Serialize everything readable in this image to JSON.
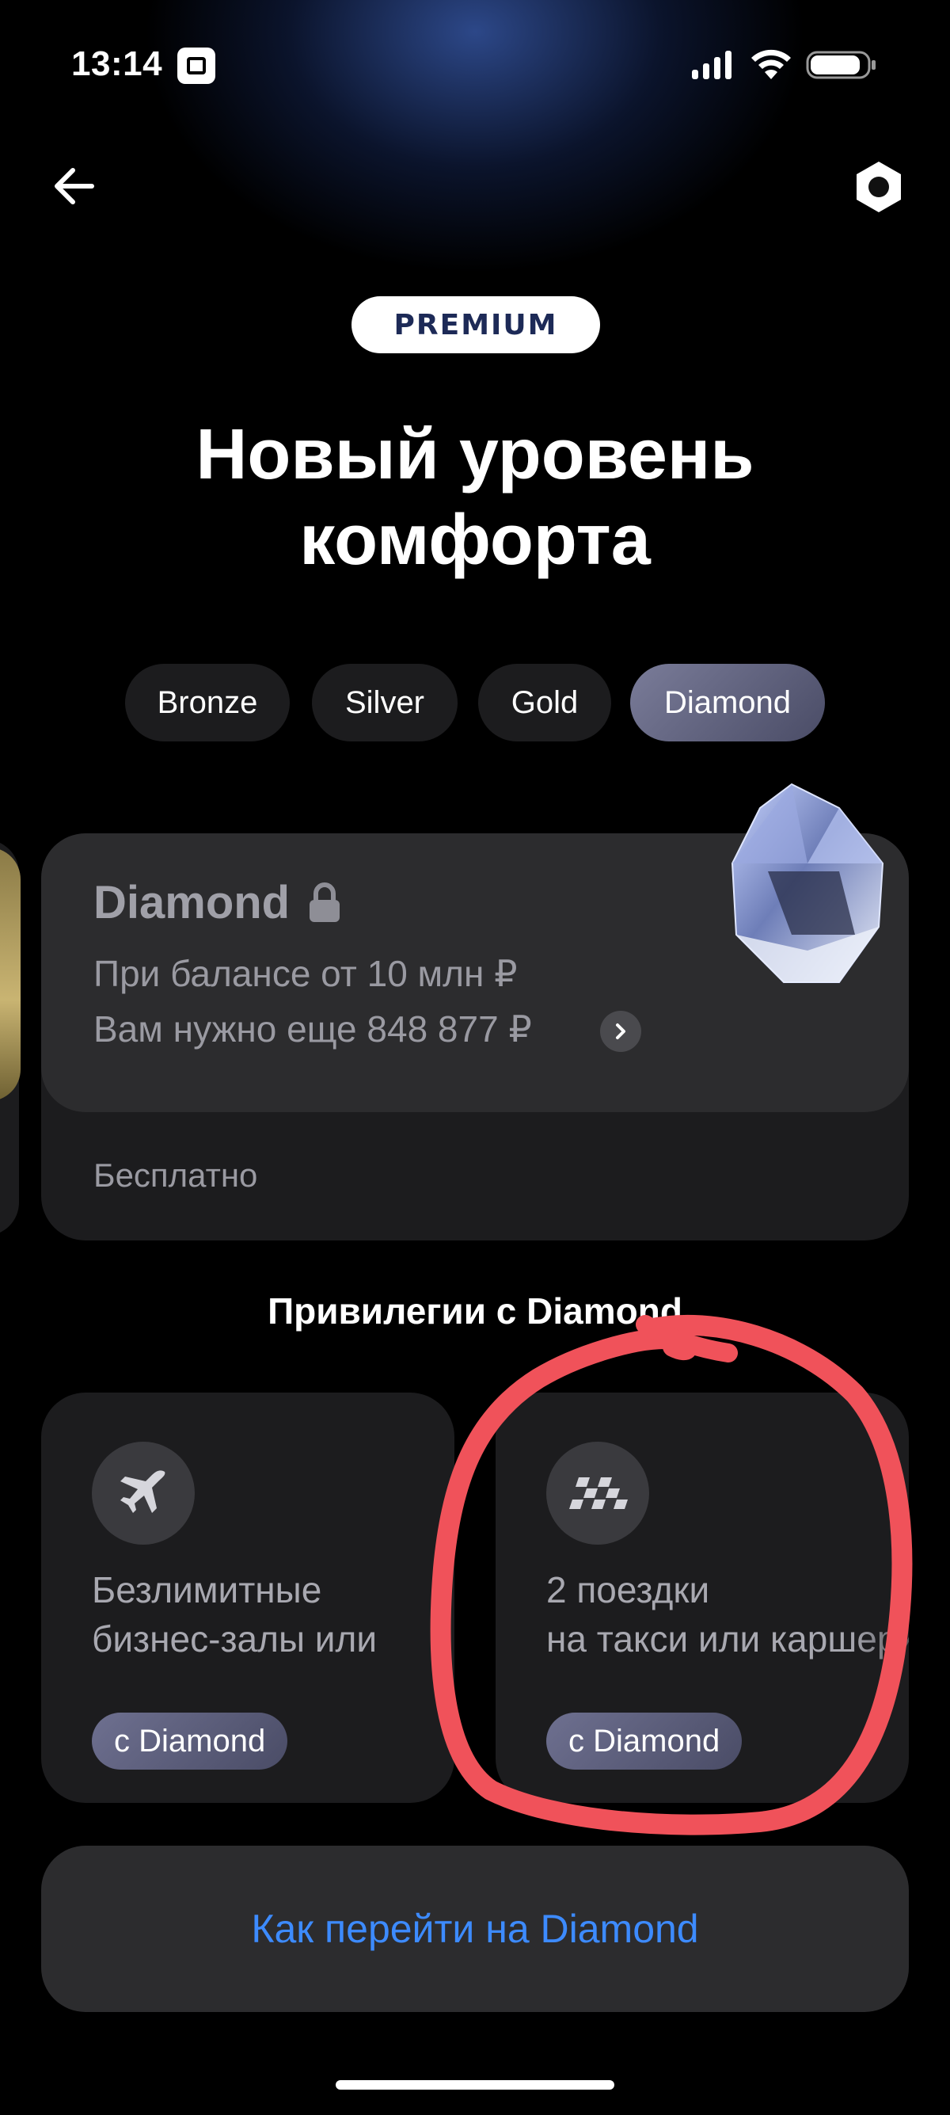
{
  "status_bar": {
    "time": "13:14",
    "icons": [
      "app-notification-icon",
      "signal-icon",
      "wifi-icon",
      "battery-icon"
    ]
  },
  "header": {
    "back_icon": "arrow-left-icon",
    "settings_icon": "hexagon-settings-icon"
  },
  "hero": {
    "badge": "PREMIUM",
    "title_line1": "Новый уровень",
    "title_line2": "комфорта"
  },
  "tiers": {
    "tabs": [
      {
        "label": "Bronze",
        "active": false
      },
      {
        "label": "Silver",
        "active": false
      },
      {
        "label": "Gold",
        "active": false
      },
      {
        "label": "Diamond",
        "active": true
      }
    ]
  },
  "tier_card": {
    "name": "Diamond",
    "lock_icon": "lock-icon",
    "condition": "При балансе от 10 млн ₽",
    "remaining": "Вам нужно еще 848 877 ₽",
    "price": "Бесплатно",
    "image": "diamond-gem-image"
  },
  "privileges": {
    "title": "Привилегии с Diamond",
    "items": [
      {
        "icon": "airplane-icon",
        "line1": "Безлимитные",
        "line2": "бизнес-залы или",
        "badge": "с Diamond"
      },
      {
        "icon": "taxi-checker-icon",
        "line1": "2 поездки",
        "line2": "на такси или каршеринг",
        "badge": "с Diamond"
      }
    ]
  },
  "cta": {
    "label": "Как перейти на Diamond"
  },
  "colors": {
    "background": "#000000",
    "card": "#1c1c1e",
    "card_top": "#2c2c2e",
    "accent_link": "#3d8bff",
    "annotation": "#f0525a"
  }
}
